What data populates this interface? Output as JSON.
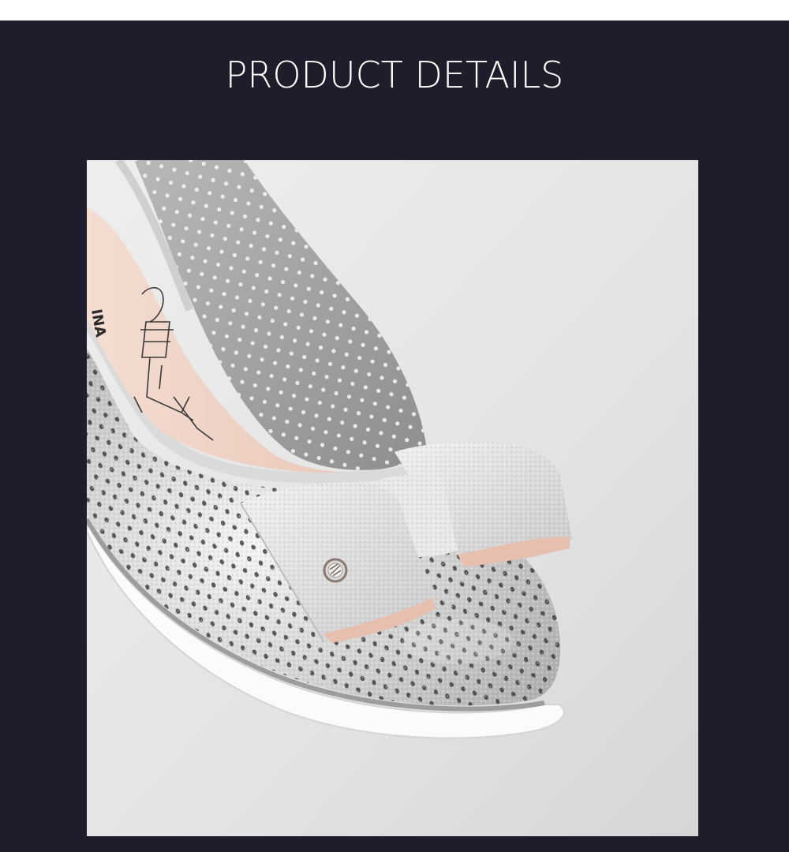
{
  "page": {
    "title": "PRODUCT DETAILS",
    "background_color": "#1d1d2b",
    "title_color": "#ffffff"
  },
  "photo": {
    "subject": "silver-perforated-ballet-flat-with-bow",
    "insole_print": "INA"
  }
}
